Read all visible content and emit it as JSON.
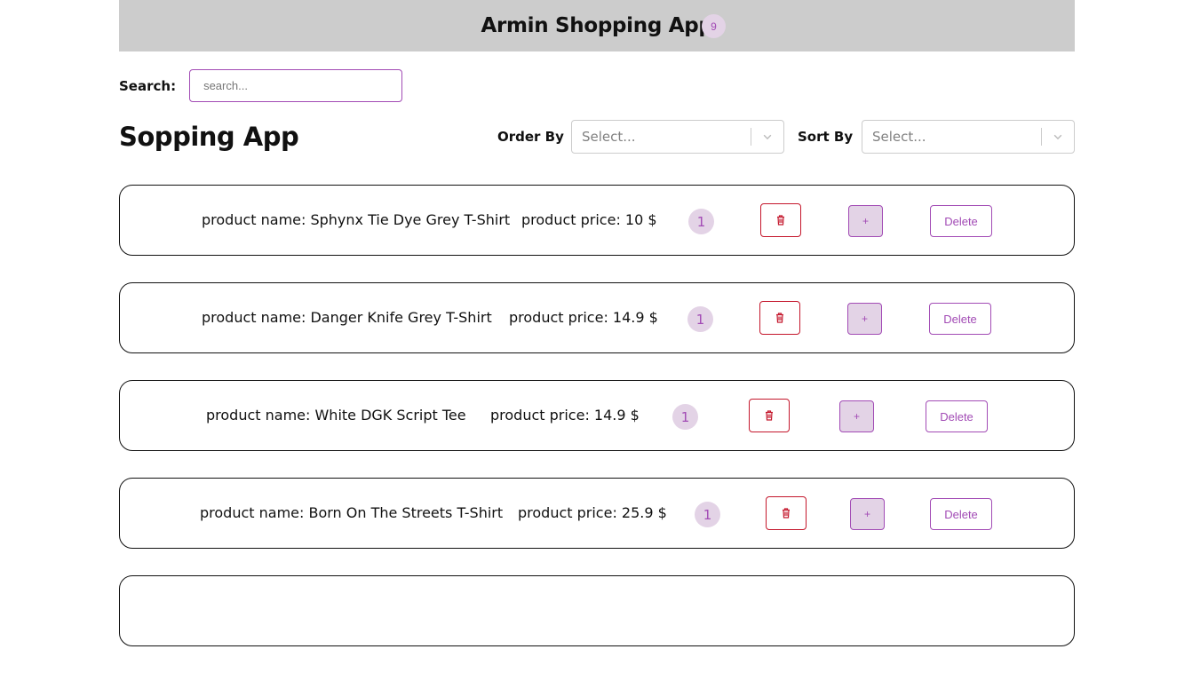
{
  "header": {
    "title": "Armin Shopping App",
    "cart_count": "9"
  },
  "search": {
    "label": "Search:",
    "placeholder": "search...",
    "value": ""
  },
  "page": {
    "title": "Sopping App"
  },
  "controls": {
    "order_by": {
      "label": "Order By",
      "value": "Select..."
    },
    "sort_by": {
      "label": "Sort By",
      "value": "Select..."
    }
  },
  "products": [
    {
      "name": "product name: Sphynx Tie Dye Grey T-Shirt",
      "price": "product price: 10 $",
      "quantity": "1",
      "add_label": "+",
      "delete_label": "Delete"
    },
    {
      "name": "product name: Danger Knife Grey T-Shirt",
      "price": "product price: 14.9 $",
      "quantity": "1",
      "add_label": "+",
      "delete_label": "Delete"
    },
    {
      "name": "product name: White DGK Script Tee",
      "price": "product price: 14.9 $",
      "quantity": "1",
      "add_label": "+",
      "delete_label": "Delete"
    },
    {
      "name": "product name: Born On The Streets T-Shirt",
      "price": "product price: 25.9 $",
      "quantity": "1",
      "add_label": "+",
      "delete_label": "Delete"
    },
    {
      "name": "",
      "price": "",
      "quantity": "",
      "add_label": "",
      "delete_label": ""
    }
  ],
  "icons": {
    "trash": "trash-icon",
    "chevron": "chevron-down-icon"
  },
  "colors": {
    "accent": "#a24bb5",
    "accent_light": "#e3d3e6",
    "danger": "#c4172c",
    "header_bg": "#cccccc"
  }
}
